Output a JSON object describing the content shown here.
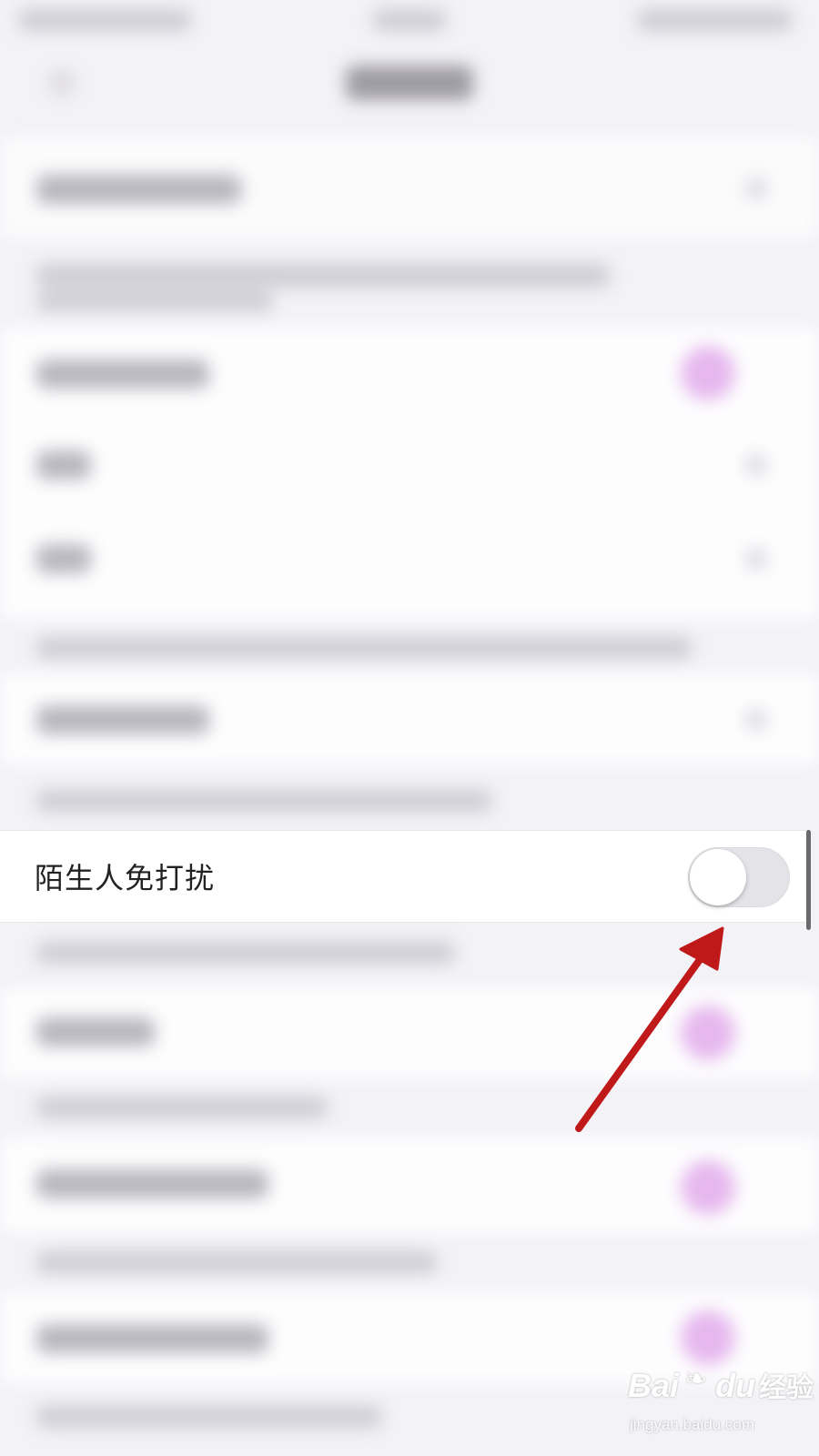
{
  "setting_row": {
    "label": "陌生人免打扰",
    "toggle_on": false
  },
  "watermark": {
    "logo_text": "Bai",
    "logo_text_2": "du",
    "logo_suffix": "经验",
    "url": "jingyan.baidu.com"
  },
  "colors": {
    "background": "#f3f2f6",
    "row_background": "#ffffff",
    "toggle_off": "#e4e3e8",
    "arrow": "#c0191a",
    "blurred_accent": "#e6b8ee"
  }
}
